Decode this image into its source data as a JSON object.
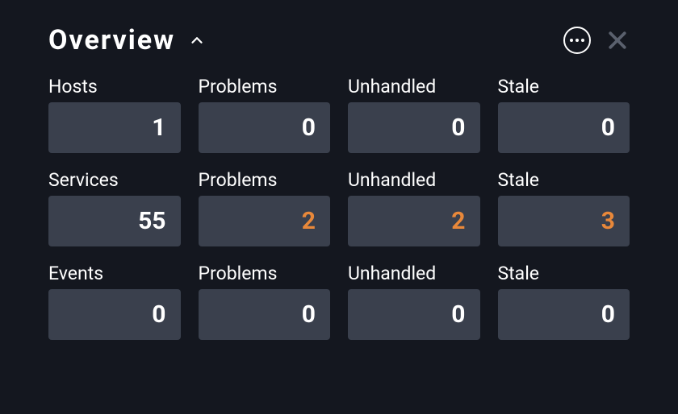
{
  "header": {
    "title": "Overview"
  },
  "grid": {
    "rows": [
      {
        "labels": [
          "Hosts",
          "Problems",
          "Unhandled",
          "Stale"
        ],
        "values": [
          "1",
          "0",
          "0",
          "0"
        ],
        "warn": [
          false,
          false,
          false,
          false
        ]
      },
      {
        "labels": [
          "Services",
          "Problems",
          "Unhandled",
          "Stale"
        ],
        "values": [
          "55",
          "2",
          "2",
          "3"
        ],
        "warn": [
          false,
          true,
          true,
          true
        ]
      },
      {
        "labels": [
          "Events",
          "Problems",
          "Unhandled",
          "Stale"
        ],
        "values": [
          "0",
          "0",
          "0",
          "0"
        ],
        "warn": [
          false,
          false,
          false,
          false
        ]
      }
    ]
  }
}
